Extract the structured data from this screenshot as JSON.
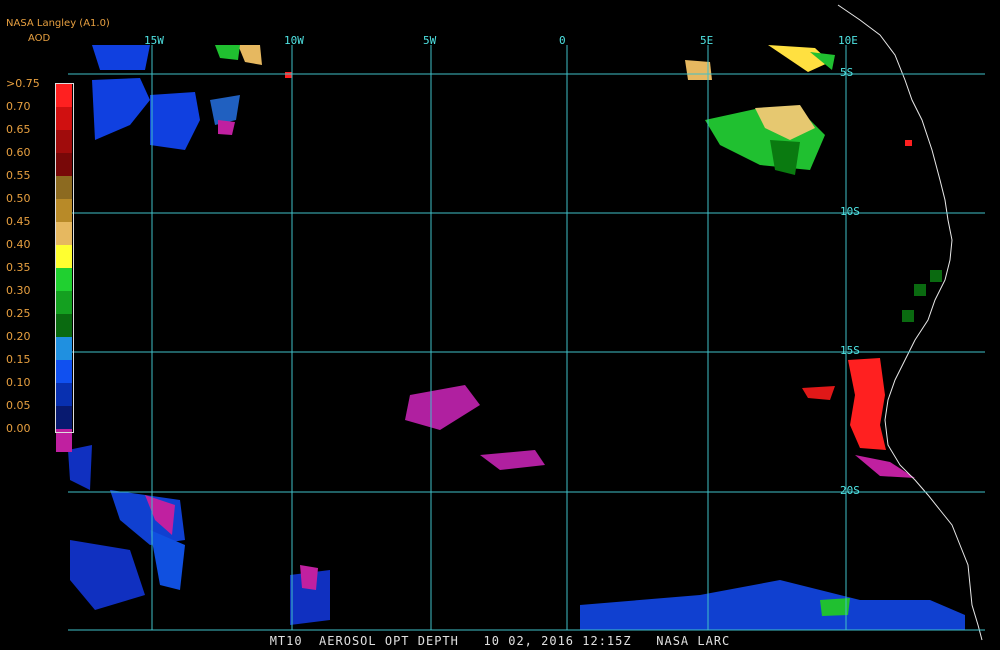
{
  "header": {
    "source": "NASA Langley (A1.0)",
    "product": "AOD"
  },
  "legend": {
    "labels": [
      ">0.75",
      "0.70",
      "0.65",
      "0.60",
      "0.55",
      "0.50",
      "0.45",
      "0.40",
      "0.35",
      "0.30",
      "0.25",
      "0.20",
      "0.15",
      "0.10",
      "0.05",
      "0.00"
    ],
    "colors": [
      "#ff2020",
      "#d01010",
      "#a00c0c",
      "#780808",
      "#8c6a20",
      "#b88a28",
      "#e6b860",
      "#ffff30",
      "#20d030",
      "#14a020",
      "#0a6a10",
      "#2090e0",
      "#1050f0",
      "#0830b0",
      "#081a70",
      "#c020a0"
    ]
  },
  "grid": {
    "longitudes": [
      "15W",
      "10W",
      "5W",
      "0",
      "5E",
      "10E"
    ],
    "latitudes": [
      "5S",
      "10S",
      "15S",
      "20S"
    ],
    "color": "#40c0c8"
  },
  "footer": {
    "text": "MT10  AEROSOL OPT DEPTH   10 02, 2016 12:15Z   NASA LARC"
  }
}
